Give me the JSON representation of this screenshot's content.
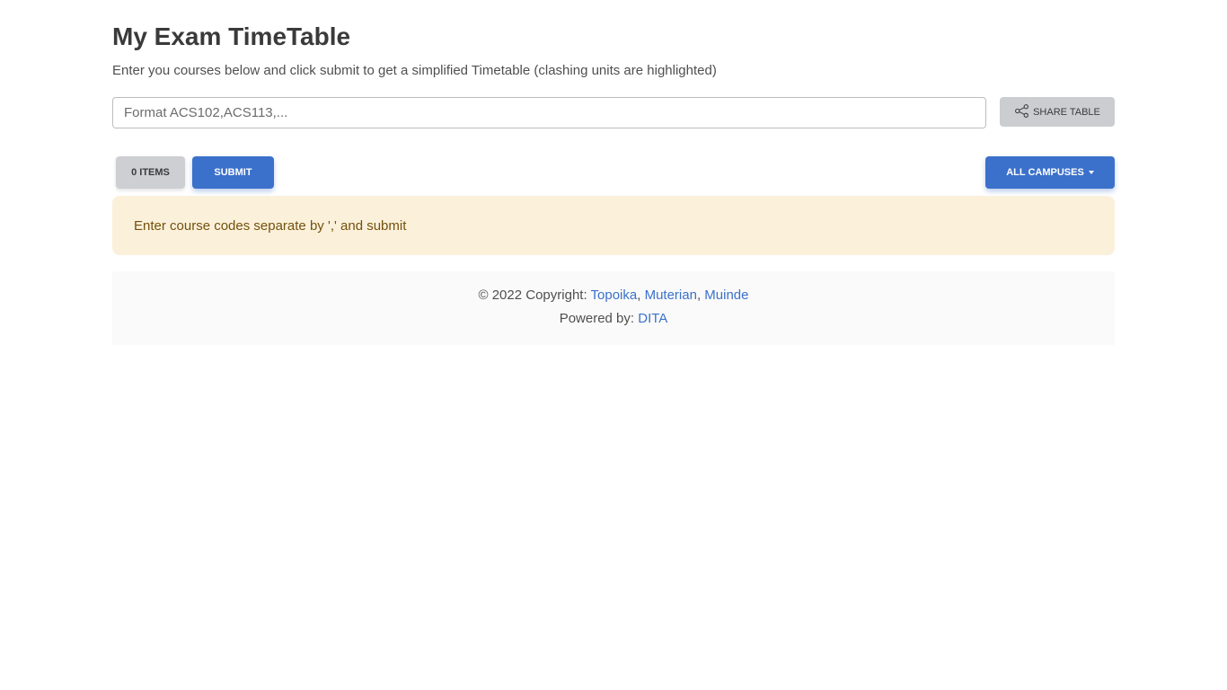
{
  "header": {
    "title": "My Exam TimeTable",
    "subtitle": "Enter you courses below and click submit to get a simplified Timetable (clashing units are highlighted)"
  },
  "course_input": {
    "placeholder": "Format ACS102,ACS113,...",
    "value": ""
  },
  "toolbar": {
    "share_label": "SHARE TABLE",
    "share_icon": "share-icon",
    "items_label": "0 ITEMS",
    "submit_label": "SUBMIT",
    "campus_label": "ALL CAMPUSES"
  },
  "alert": {
    "message": "Enter course codes separate by ',' and submit"
  },
  "footer": {
    "copyright_prefix": "© 2022 Copyright:",
    "authors": [
      "Topoika",
      "Muterian",
      "Muinde"
    ],
    "separator": ",",
    "powered_prefix": "Powered by:",
    "powered_link": "DITA"
  },
  "colors": {
    "primary": "#3b71ca",
    "secondary": "#cdcfd3",
    "alert_bg": "#fbf0da",
    "alert_text": "#73510d"
  }
}
